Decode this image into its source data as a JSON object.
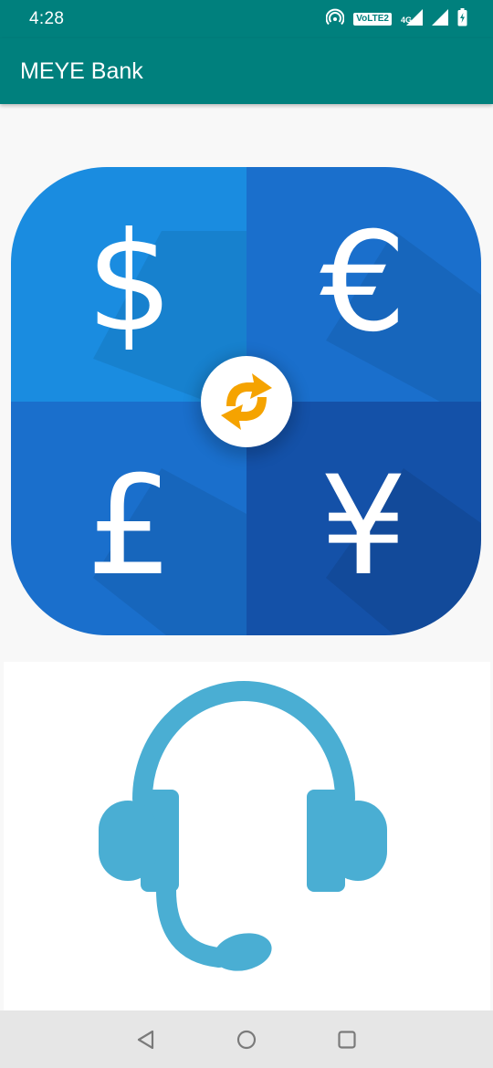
{
  "status_bar": {
    "time": "4:28",
    "volte_label": "VoLTE2",
    "network_label": "4G",
    "icons": [
      "hotspot-icon",
      "signal-icon",
      "signal-icon",
      "battery-icon"
    ]
  },
  "app_bar": {
    "title": "MEYE Bank"
  },
  "currency_card": {
    "symbols": [
      "$",
      "€",
      "£",
      "¥"
    ],
    "icon": "swap-arrows-icon",
    "colors": {
      "top_left": "#1a8ce0",
      "top_right": "#1a6fcc",
      "bottom_left": "#1a6fcc",
      "bottom_right": "#1451a8",
      "swap_arrow": "#f5a300"
    }
  },
  "support_card": {
    "icon": "headset-icon",
    "color": "#4aaed3"
  },
  "nav_bar": {
    "icons": [
      "back-icon",
      "home-icon",
      "recents-icon"
    ]
  },
  "theme": {
    "primary": "#00807d"
  }
}
